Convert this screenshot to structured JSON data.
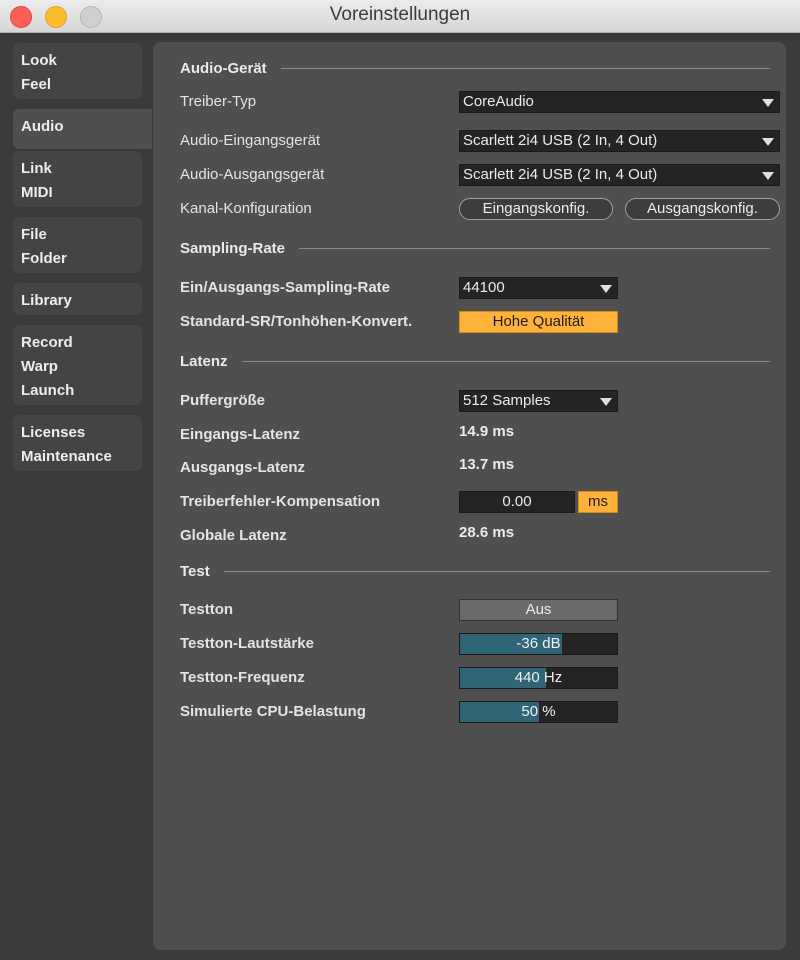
{
  "window": {
    "title": "Voreinstellungen"
  },
  "sidebar": {
    "items": [
      {
        "lines": [
          "Look",
          "Feel"
        ]
      },
      {
        "lines": [
          "Audio"
        ],
        "active": true
      },
      {
        "lines": [
          "Link",
          "MIDI"
        ]
      },
      {
        "lines": [
          "File",
          "Folder"
        ]
      },
      {
        "lines": [
          "Library"
        ]
      },
      {
        "lines": [
          "Record",
          "Warp",
          "Launch"
        ]
      },
      {
        "lines": [
          "Licenses",
          "Maintenance"
        ]
      }
    ]
  },
  "audio_device": {
    "heading": "Audio-Gerät",
    "driver_type_label": "Treiber-Typ",
    "driver_type_value": "CoreAudio",
    "input_device_label": "Audio-Eingangsgerät",
    "input_device_value": "Scarlett 2i4 USB (2 In, 4 Out)",
    "output_device_label": "Audio-Ausgangsgerät",
    "output_device_value": "Scarlett 2i4 USB (2 In, 4 Out)",
    "channel_config_label": "Kanal-Konfiguration",
    "input_config_button": "Eingangskonfig.",
    "output_config_button": "Ausgangskonfig."
  },
  "sampling_rate": {
    "heading": "Sampling-Rate",
    "rate_label": "Ein/Ausgangs-Sampling-Rate",
    "rate_value": "44100",
    "conversion_label": "Standard-SR/Tonhöhen-Konvert.",
    "conversion_value": "Hohe Qualität"
  },
  "latency": {
    "heading": "Latenz",
    "buffer_label": "Puffergröße",
    "buffer_value": "512 Samples",
    "input_latency_label": "Eingangs-Latenz",
    "input_latency_value": "14.9 ms",
    "output_latency_label": "Ausgangs-Latenz",
    "output_latency_value": "13.7 ms",
    "driver_comp_label": "Treiberfehler-Kompensation",
    "driver_comp_value": "0.00",
    "driver_comp_unit": "ms",
    "global_latency_label": "Globale Latenz",
    "global_latency_value": "28.6 ms"
  },
  "test": {
    "heading": "Test",
    "tone_label": "Testton",
    "tone_value": "Aus",
    "volume_label": "Testton-Lautstärke",
    "volume_value": "-36 dB",
    "volume_level": 0.65,
    "frequency_label": "Testton-Frequenz",
    "frequency_value": "440 Hz",
    "frequency_level": 0.55,
    "cpu_label": "Simulierte CPU-Belastung",
    "cpu_value": "50 %",
    "cpu_level": 0.5
  },
  "colors": {
    "accent": "#ffb23a",
    "slider_fill": "#2f6576",
    "panel": "#4f4f4f",
    "background": "#3a3a3a"
  }
}
